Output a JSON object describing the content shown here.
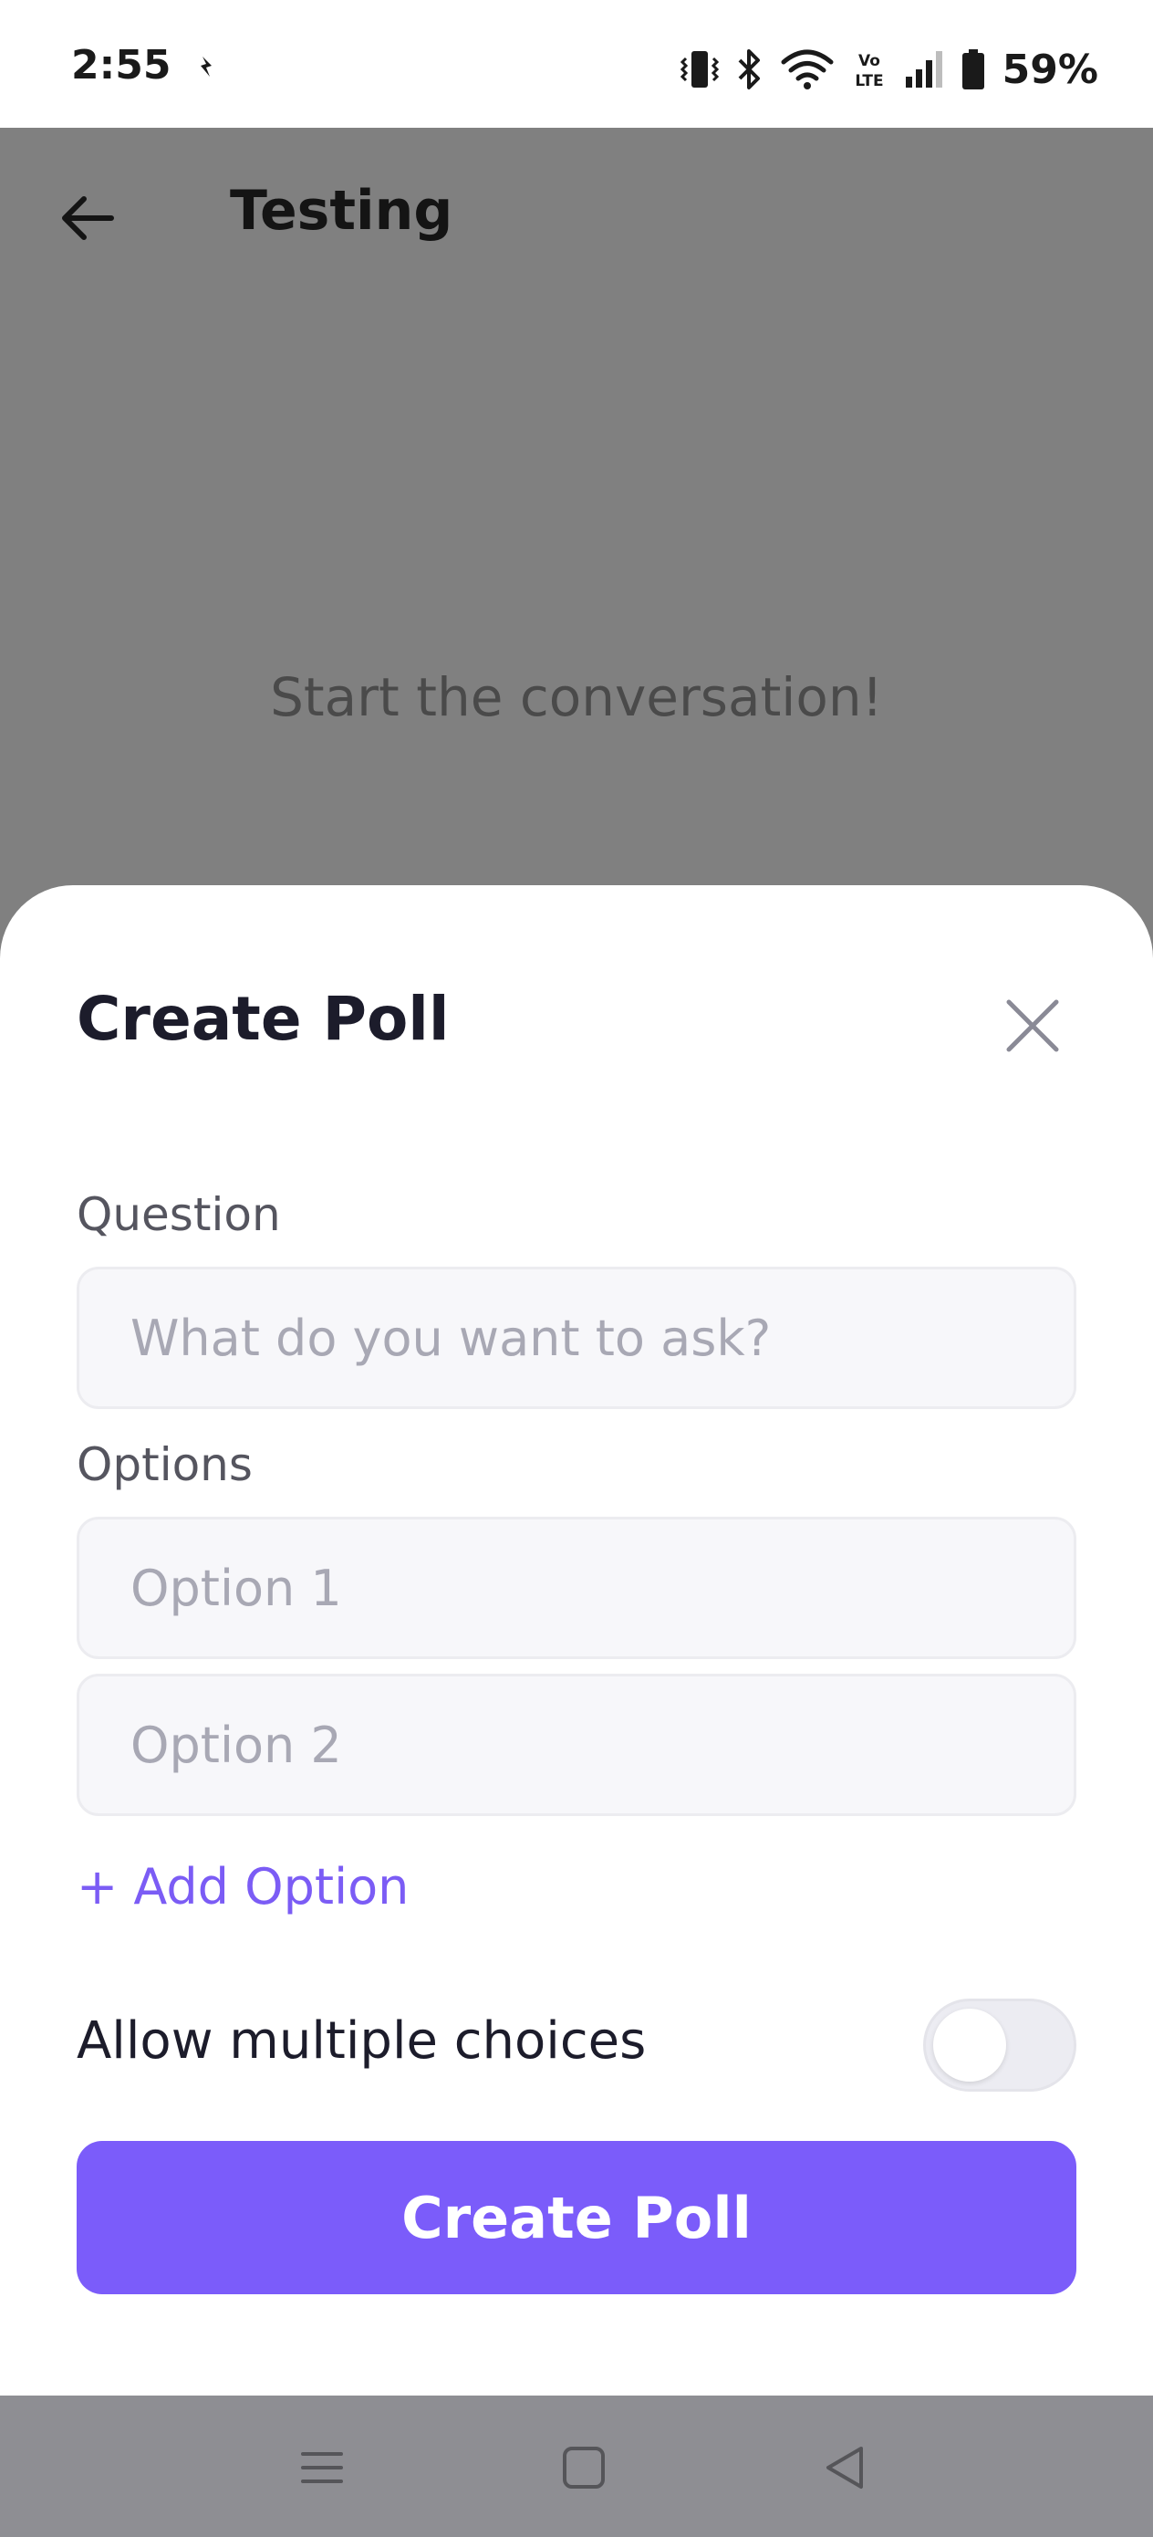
{
  "status_bar": {
    "time": "2:55",
    "battery": "59%",
    "icons": [
      "notification-icon",
      "vibrate-icon",
      "bluetooth-icon",
      "wifi-icon",
      "volte-icon",
      "signal-icon",
      "battery-icon"
    ],
    "volte_top": "Vo",
    "volte_bottom": "LTE"
  },
  "chat": {
    "title": "Testing",
    "empty_message": "Start the conversation!"
  },
  "poll_sheet": {
    "title": "Create Poll",
    "question_label": "Question",
    "question_placeholder": "What do you want to ask?",
    "question_value": "",
    "options_label": "Options",
    "options": [
      {
        "placeholder": "Option 1",
        "value": ""
      },
      {
        "placeholder": "Option 2",
        "value": ""
      }
    ],
    "add_option_label": "+ Add Option",
    "multiple_choices_label": "Allow multiple choices",
    "multiple_choices_enabled": false,
    "submit_label": "Create Poll"
  },
  "colors": {
    "accent": "#7b5cfa",
    "backdrop": "#808080",
    "nav_bar": "#8e8e93"
  },
  "nav_bar": {
    "icons": [
      "recents-icon",
      "home-icon",
      "back-icon"
    ]
  }
}
